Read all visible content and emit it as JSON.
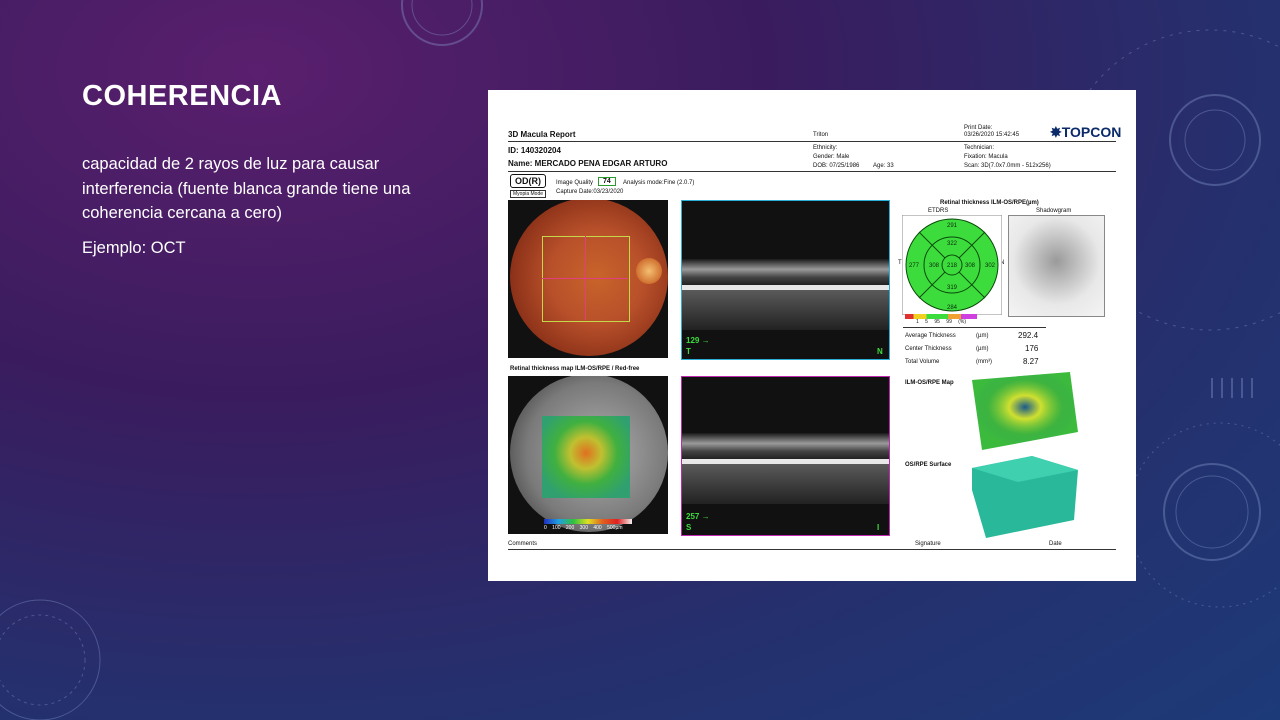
{
  "slide": {
    "title": "COHERENCIA",
    "paragraph1": "capacidad de 2 rayos de luz para causar interferencia (fuente blanca grande tiene una coherencia cercana a cero)",
    "paragraph2": "Ejemplo: OCT"
  },
  "report": {
    "title": "3D Macula Report",
    "device": "Triton",
    "print_date_label": "Print Date:",
    "print_date": "03/26/2020 15:42:45",
    "brand": "TOPCON",
    "id": "ID: 140320204",
    "name": "Name: MERCADO PENA EDGAR ARTURO",
    "ethnicity": "Ethnicity:",
    "gender": "Gender: Male",
    "dob": "DOB: 07/25/1986",
    "age": "Age: 33",
    "technician": "Technician:",
    "fixation": "Fixation: Macula",
    "scan": "Scan: 3D(7.0x7.0mm - 512x256)",
    "eye": "OD(R)",
    "myopia_mode": "Myopia Mode",
    "image_quality_label": "Image Quality",
    "image_quality": "74",
    "analysis_mode": "Analysis mode:Fine (2.0.7)",
    "capture_date": "Capture Date:03/23/2020",
    "thickness_title": "Retinal thickness ILM-OS/RPE(µm)",
    "etdrs_label": "ETDRS",
    "shadowgram_label": "Shadowgram",
    "etdrs_values": [
      "291",
      "322",
      "277",
      "308",
      "218",
      "308",
      "302",
      "319",
      "284"
    ],
    "etdrs_side_t": "T",
    "etdrs_side_n": "N",
    "scale_labels": [
      "1",
      "5",
      "95",
      "99",
      "(%)"
    ],
    "avg_thickness_label": "Average Thickness",
    "center_thickness_label": "Center Thickness",
    "total_volume_label": "Total Volume",
    "unit_um": "(µm)",
    "unit_mm3": "(mm³)",
    "avg_thickness": "292.4",
    "center_thickness": "176",
    "total_volume": "8.27",
    "scan1_num": "129",
    "scan1_left": "T",
    "scan1_right": "N",
    "scan2_num": "257",
    "scan2_left": "S",
    "scan2_right": "I",
    "map_title": "Retinal thickness map ILM-OS/RPE / Red-free",
    "colorbar_labels": [
      "0",
      "100",
      "200",
      "300",
      "400",
      "500µm"
    ],
    "ilm_map_label": "ILM-OS/RPE Map",
    "os_surface_label": "OS/RPE Surface",
    "comments": "Comments",
    "signature": "Signature",
    "date": "Date"
  },
  "colors": {
    "accent_green": "#3ddc3d",
    "cyan_frame": "#2ab0d8",
    "magenta_frame": "#c02ab0"
  }
}
